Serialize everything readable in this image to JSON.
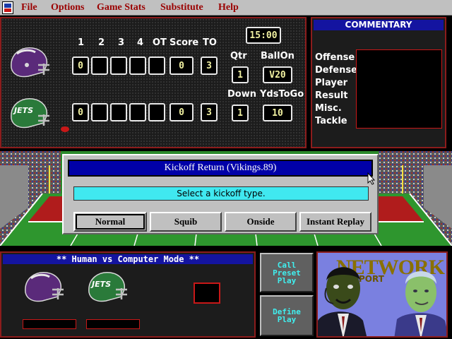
{
  "menu": {
    "items": [
      "File",
      "Options",
      "Game Stats",
      "Substitute",
      "Help"
    ]
  },
  "scoreboard": {
    "headers": [
      "1",
      "2",
      "3",
      "4",
      "OT",
      "Score",
      "TO"
    ],
    "clock": "15:00",
    "labels": {
      "qtr": "Qtr",
      "ball_on": "BallOn",
      "down": "Down",
      "yds_to_go": "YdsToGo"
    },
    "teams": [
      {
        "name": "Vikings",
        "quarters": [
          "0",
          "",
          "",
          "",
          ""
        ],
        "score": "0",
        "timeouts": "3"
      },
      {
        "name": "Jets",
        "quarters": [
          "0",
          "",
          "",
          "",
          ""
        ],
        "score": "0",
        "timeouts": "3"
      }
    ],
    "qtr": "1",
    "ball_on": "V20",
    "down": "1",
    "yds_to_go": "10",
    "jets_logo": "JETS"
  },
  "commentary": {
    "title": "COMMENTARY",
    "labels": [
      "Offense",
      "Defense",
      "Player",
      "Result",
      "Misc.",
      "Tackle"
    ]
  },
  "dialog": {
    "title": "Kickoff Return (Vikings.89)",
    "message": "Select a kickoff type.",
    "buttons": [
      "Normal",
      "Squib",
      "Onside",
      "Instant Replay"
    ]
  },
  "mode": {
    "title": "** Human vs Computer Mode **"
  },
  "side_buttons": {
    "call_preset": "Call\nPreset\nPlay",
    "define_play": "Define\nPlay"
  },
  "network": {
    "word": "NETWORK",
    "sub": "PORT"
  },
  "colors": {
    "vikings_purple": "#5a2a7a",
    "jets_green": "#2a7a3a",
    "panel_border": "#8c1c1c",
    "title_blue": "#1414a0"
  }
}
